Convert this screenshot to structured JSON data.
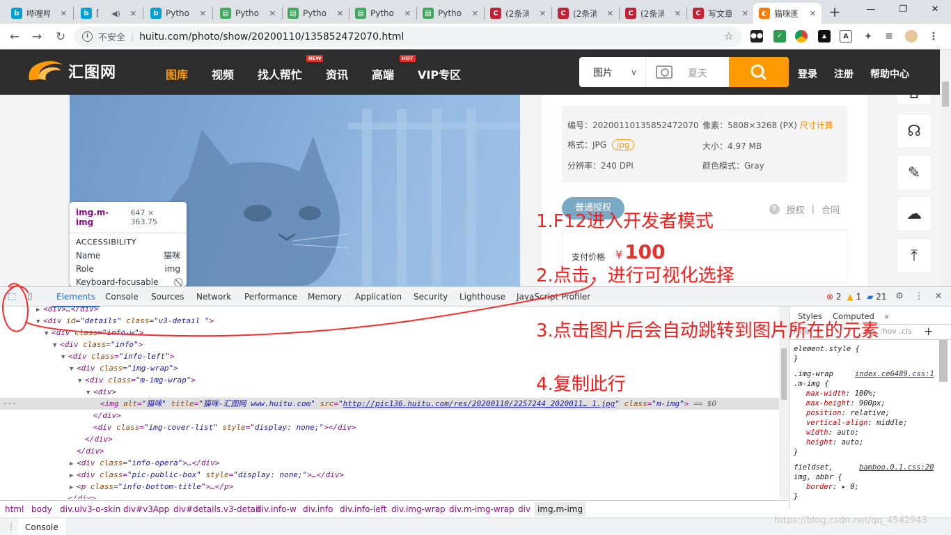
{
  "browser": {
    "tabs": [
      {
        "icon": "bilibili-icon",
        "title": "哔哩哔"
      },
      {
        "icon": "bilibili-icon",
        "title": "[ "
      },
      {
        "icon": "bilibili-icon",
        "title": "Pytho"
      },
      {
        "icon": "python-icon",
        "title": "Pytho"
      },
      {
        "icon": "python-icon",
        "title": "Pytho"
      },
      {
        "icon": "python-icon",
        "title": "Pytho"
      },
      {
        "icon": "python-icon",
        "title": "Pytho"
      },
      {
        "icon": "csdn-icon",
        "title": "(2条消"
      },
      {
        "icon": "csdn-icon",
        "title": "(2条消"
      },
      {
        "icon": "csdn-icon",
        "title": "(2条消"
      },
      {
        "icon": "csdn-icon",
        "title": "写文章"
      },
      {
        "icon": "huitu-icon",
        "title": "猫咪图"
      }
    ],
    "security_label": "不安全",
    "url": "huitu.com/photo/show/20200110/135852472070.html"
  },
  "site": {
    "logo_text": "汇图网",
    "nav": [
      {
        "label": "图库",
        "active": true
      },
      {
        "label": "视频"
      },
      {
        "label": "找人帮忙",
        "badge": "NEW"
      },
      {
        "label": "资讯"
      },
      {
        "label": "高端",
        "badge": "HOT"
      },
      {
        "label": "VIP专区"
      }
    ],
    "search_category": "图片",
    "search_placeholder": "夏天",
    "login": "登录",
    "register": "注册",
    "help": "帮助中心"
  },
  "detail": {
    "id_label": "编号：20200110135852472070",
    "pixels_label": "像素：5808×3268 (PX)",
    "size_calc": "尺寸计算",
    "format_label": "格式：JPG",
    "format_tag": "jpg",
    "filesize_label": "大小：4.97 MB",
    "dpi_label": "分辨率：240 DPI",
    "color_label": "颜色模式：Gray",
    "license_button": "普通授权",
    "auth_label": "授权",
    "contract_label": "合同",
    "price_label": "支付价格",
    "currency": "¥",
    "price": "100"
  },
  "tooltip": {
    "tag": "img.m-img",
    "dims": "647 × 363.75",
    "section": "ACCESSIBILITY",
    "rows": [
      {
        "k": "Name",
        "v": "猫咪"
      },
      {
        "k": "Role",
        "v": "img"
      },
      {
        "k": "Keyboard-focusable",
        "v": "⃠"
      }
    ]
  },
  "devtools": {
    "tabs": [
      "Elements",
      "Console",
      "Sources",
      "Network",
      "Performance",
      "Memory",
      "Application",
      "Security",
      "Lighthouse",
      "JavaScript Profiler"
    ],
    "errors": "2",
    "warnings": "1",
    "messages": "21",
    "styles_tabs": [
      "Styles",
      "Computed"
    ],
    "filter_label": "Filter",
    "filter_right": ":hov .cls",
    "breadcrumbs": [
      "html",
      "body",
      "div.uiv3-o-skin",
      "div#v3App",
      "div#details.v3-detail",
      "div.info-w",
      "div.info",
      "div.info-left",
      "div.img-wrap",
      "div.m-img-wrap",
      "div",
      "img.m-img"
    ],
    "drawer_tab": "Console"
  },
  "annotations": [
    "1.F12进入开发者模式",
    "2.点击，进行可视化选择",
    "3.点击图片后会自动跳转到图片所在的元素",
    "4.复制此行"
  ],
  "watermark": "https://blog.csdn.net/qq_4542943"
}
